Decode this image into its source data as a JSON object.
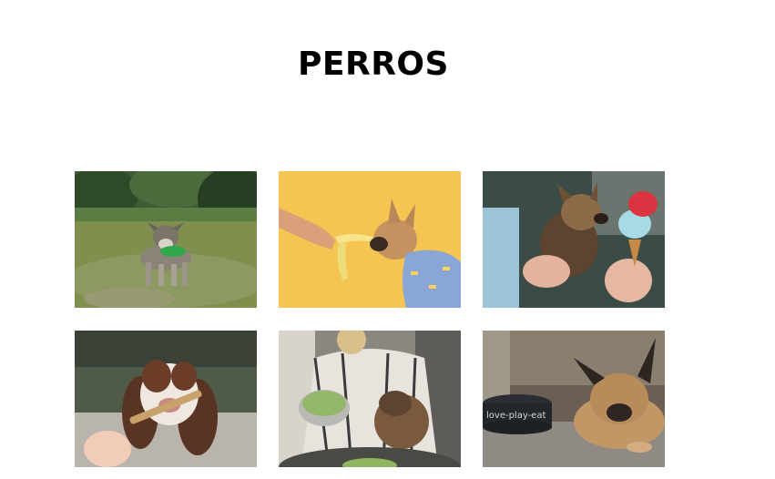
{
  "page": {
    "title": "PERROS"
  },
  "gallery": {
    "photos": [
      {
        "name": "schnauzer-with-green-bandana",
        "icon": "dog-photo"
      },
      {
        "name": "french-bulldog-sniffing-banana",
        "icon": "dog-photo"
      },
      {
        "name": "yorkshire-terrier-with-ice-cream",
        "icon": "dog-photo"
      },
      {
        "name": "spaniel-chewing-stick",
        "icon": "dog-photo"
      },
      {
        "name": "woman-feeding-dog-salad",
        "icon": "dog-photo"
      },
      {
        "name": "french-bulldog-near-bowl",
        "icon": "dog-photo"
      }
    ]
  },
  "bowl_text": "love-play-eat"
}
